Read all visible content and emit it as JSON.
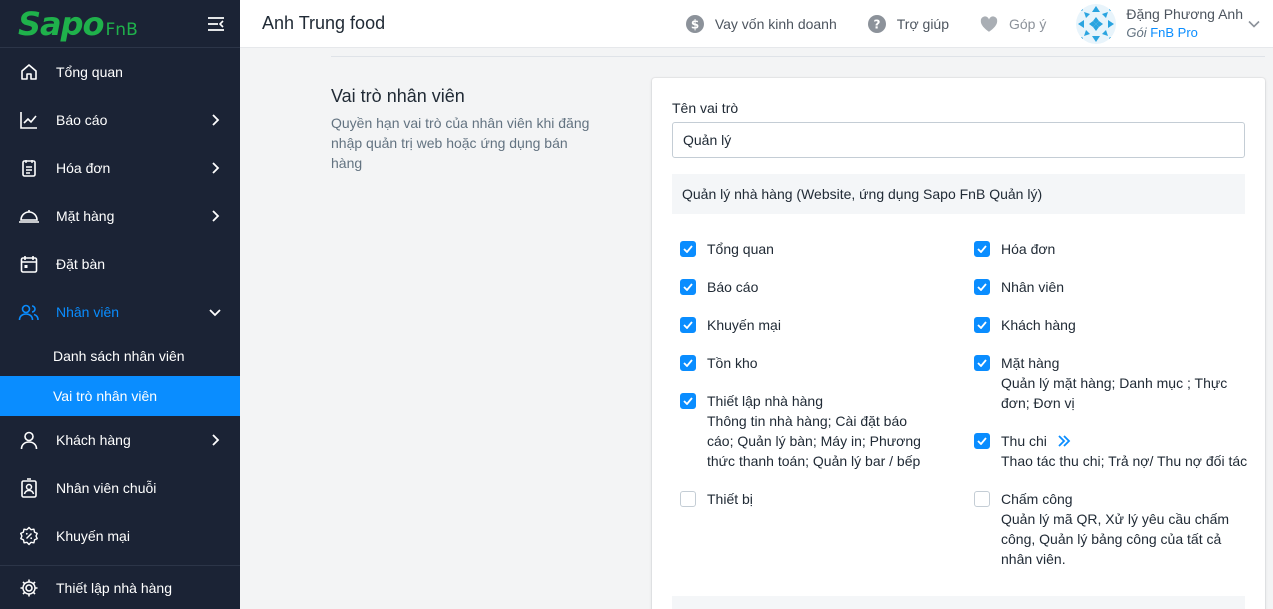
{
  "brand": {
    "logo_main": "Sapo",
    "logo_sub": "FnB",
    "color": "#1fb14b"
  },
  "sidebar": {
    "items": [
      {
        "label": "Tổng quan",
        "icon": "home-icon"
      },
      {
        "label": "Báo cáo",
        "icon": "chart-line-icon"
      },
      {
        "label": "Hóa đơn",
        "icon": "receipt-icon"
      },
      {
        "label": "Mặt hàng",
        "icon": "cloche-icon"
      },
      {
        "label": "Đặt bàn",
        "icon": "calendar-icon"
      },
      {
        "label": "Nhân viên",
        "icon": "users-icon"
      },
      {
        "label": "Khách hàng",
        "icon": "user-icon"
      },
      {
        "label": "Nhân viên chuỗi",
        "icon": "badge-icon"
      },
      {
        "label": "Khuyến mại",
        "icon": "promotion-icon"
      }
    ],
    "subitems": [
      {
        "label": "Danh sách nhân viên"
      },
      {
        "label": "Vai trò nhân viên"
      }
    ],
    "bottom": {
      "label": "Thiết lập nhà hàng",
      "icon": "gear-icon"
    }
  },
  "header": {
    "store_name": "Anh Trung food",
    "loan": "Vay vốn kinh doanh",
    "help": "Trợ giúp",
    "feedback": "Góp ý",
    "user_name": "Đặng Phương Anh",
    "plan_prefix": "Gói ",
    "plan": "FnB Pro"
  },
  "section": {
    "title": "Vai trò nhân viên",
    "description": "Quyền hạn vai trò của nhân viên khi đăng nhập quản trị web hoặc ứng dụng bán hàng"
  },
  "form": {
    "role_label": "Tên vai trò",
    "role_value": "Quản lý",
    "group_title": "Quản lý nhà hàng (Website, ứng dụng Sapo FnB Quản lý)"
  },
  "permissions": {
    "left": [
      {
        "title": "Tổng quan",
        "checked": true,
        "desc": ""
      },
      {
        "title": "Báo cáo",
        "checked": true,
        "desc": ""
      },
      {
        "title": "Khuyến mại",
        "checked": true,
        "desc": ""
      },
      {
        "title": "Tồn kho",
        "checked": true,
        "desc": ""
      },
      {
        "title": "Thiết lập nhà hàng",
        "checked": true,
        "desc": "Thông tin nhà hàng; Cài đặt báo cáo; Quản lý bàn; Máy in; Phương thức thanh toán; Quản lý bar / bếp"
      },
      {
        "title": "Thiết bị",
        "checked": false,
        "desc": ""
      }
    ],
    "right": [
      {
        "title": "Hóa đơn",
        "checked": true,
        "desc": ""
      },
      {
        "title": "Nhân viên",
        "checked": true,
        "desc": ""
      },
      {
        "title": "Khách hàng",
        "checked": true,
        "desc": ""
      },
      {
        "title": "Mặt hàng",
        "checked": true,
        "desc": "Quản lý mặt hàng; Danh mục ; Thực đơn; Đơn vị"
      },
      {
        "title": "Thu chi",
        "checked": true,
        "desc": "Thao tác thu chi; Trả nợ/ Thu nợ đối tác"
      },
      {
        "title": "Chấm công",
        "checked": false,
        "desc": "Quản lý mã QR, Xử lý yêu cầu chấm công, Quản lý bảng công của tất cả nhân viên."
      }
    ]
  },
  "colors": {
    "sidebar_bg": "#1b2335",
    "accent": "#0a8dff"
  }
}
